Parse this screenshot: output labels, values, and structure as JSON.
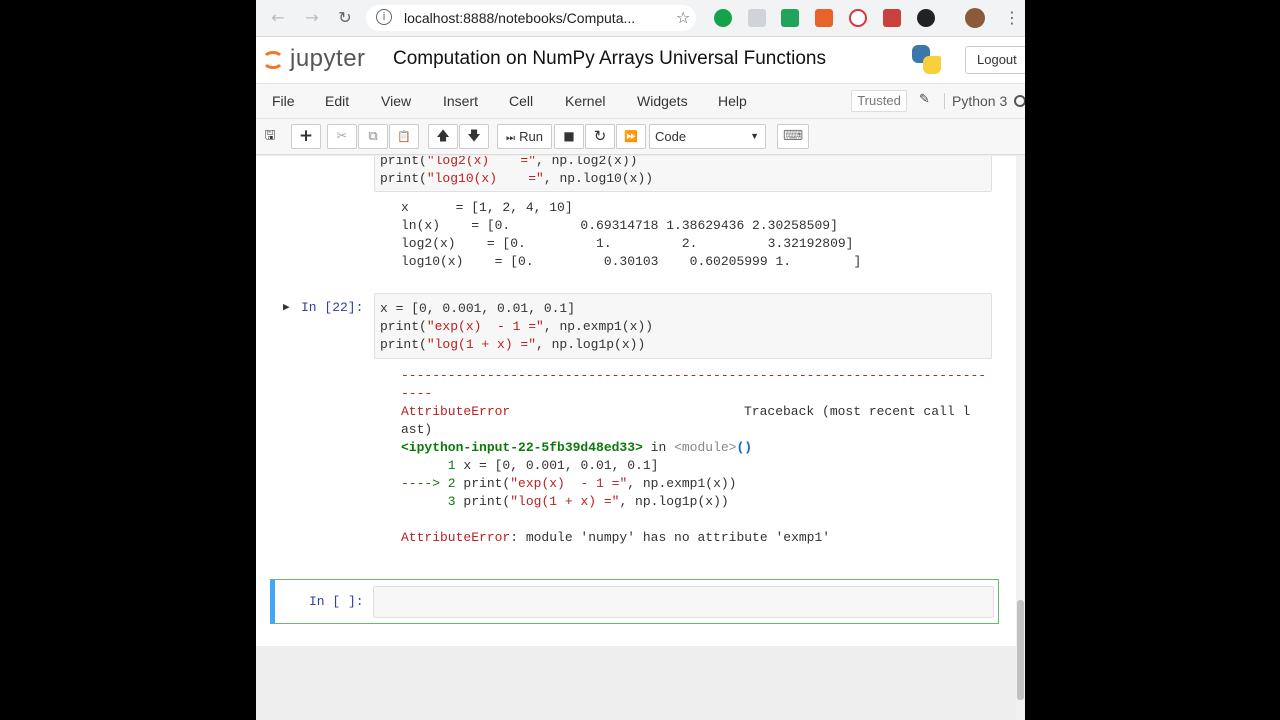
{
  "browser": {
    "url": "localhost:8888/notebooks/Computa...",
    "back_icon": "←",
    "forward_icon": "→",
    "reload_icon": "↻",
    "info_icon": "i",
    "star_icon": "☆",
    "menu_icon": "⋮"
  },
  "header": {
    "logo_text": "jupyter",
    "notebook_title": "Computation on NumPy Arrays Universal Functions",
    "logout_label": "Logout"
  },
  "menubar": {
    "items": [
      "File",
      "Edit",
      "View",
      "Insert",
      "Cell",
      "Kernel",
      "Widgets",
      "Help"
    ],
    "trusted_label": "Trusted",
    "pencil_icon": "✎",
    "kernel_name": "Python 3"
  },
  "toolbar": {
    "save_icon": "🖫",
    "add_icon": "+",
    "cut_icon": "✂",
    "copy_icon": "⧉",
    "paste_icon": "📋",
    "move_up_icon": "🡅",
    "move_down_icon": "🡇",
    "run_label": "Run",
    "run_icon": "⏭",
    "stop_icon": "■",
    "restart_icon": "↻",
    "fast_forward_icon": "⏩",
    "cell_type": "Code",
    "cell_type_arrow": "▼",
    "keyboard_icon": "⌨"
  },
  "cells": {
    "prev_input": {
      "line1_prefix": "print(",
      "line1_str": "\"log2(x)    =\"",
      "line1_suffix": ", np.log2(x))",
      "line2_prefix": "print(",
      "line2_str": "\"log10(x)    =\"",
      "line2_suffix": ", np.log10(x))"
    },
    "prev_output": [
      "x      = [1, 2, 4, 10]",
      "ln(x)    = [0.         0.69314718 1.38629436 2.30258509]",
      "log2(x)    = [0.         1.         2.         3.32192809]",
      "log10(x)    = [0.         0.30103    0.60205999 1.        ]"
    ],
    "cell22": {
      "run_icon": "▶",
      "prompt": "In [22]:",
      "line1": "x = [0, 0.001, 0.01, 0.1]",
      "line2_prefix": "print(",
      "line2_str": "\"exp(x)  - 1 =\"",
      "line2_suffix": ", np.exmp1(x))",
      "line3_prefix": "print(",
      "line3_str": "\"log(1 + x) =\"",
      "line3_suffix": ", np.log1p(x))"
    },
    "traceback": {
      "dashes": "---------------------------------------------------------------------------",
      "dashes_tail": "----",
      "error_type": "AttributeError",
      "traceback_label": "Traceback (most recent call l",
      "traceback_wrap": "ast)",
      "input_ref": "<ipython-input-22-5fb39d48ed33>",
      "in_word": " in ",
      "module_ref": "<module>",
      "module_parens": "()",
      "tb_line1_num": "      1 ",
      "tb_line1_code": "x = [0, 0.001, 0.01, 0.1]",
      "tb_line2_arrow": "----> 2 ",
      "tb_line2_prefix": "print(",
      "tb_line2_str": "\"exp(x)  - 1 =\"",
      "tb_line2_suffix": ", np.exmp1(x))",
      "tb_line3_num": "      3 ",
      "tb_line3_prefix": "print(",
      "tb_line3_str": "\"log(1 + x) =\"",
      "tb_line3_suffix": ", np.log1p(x))",
      "final_error_type": "AttributeError",
      "final_message": ": module 'numpy' has no attribute 'exmp1'"
    },
    "empty_cell": {
      "prompt": "In [ ]:"
    }
  }
}
